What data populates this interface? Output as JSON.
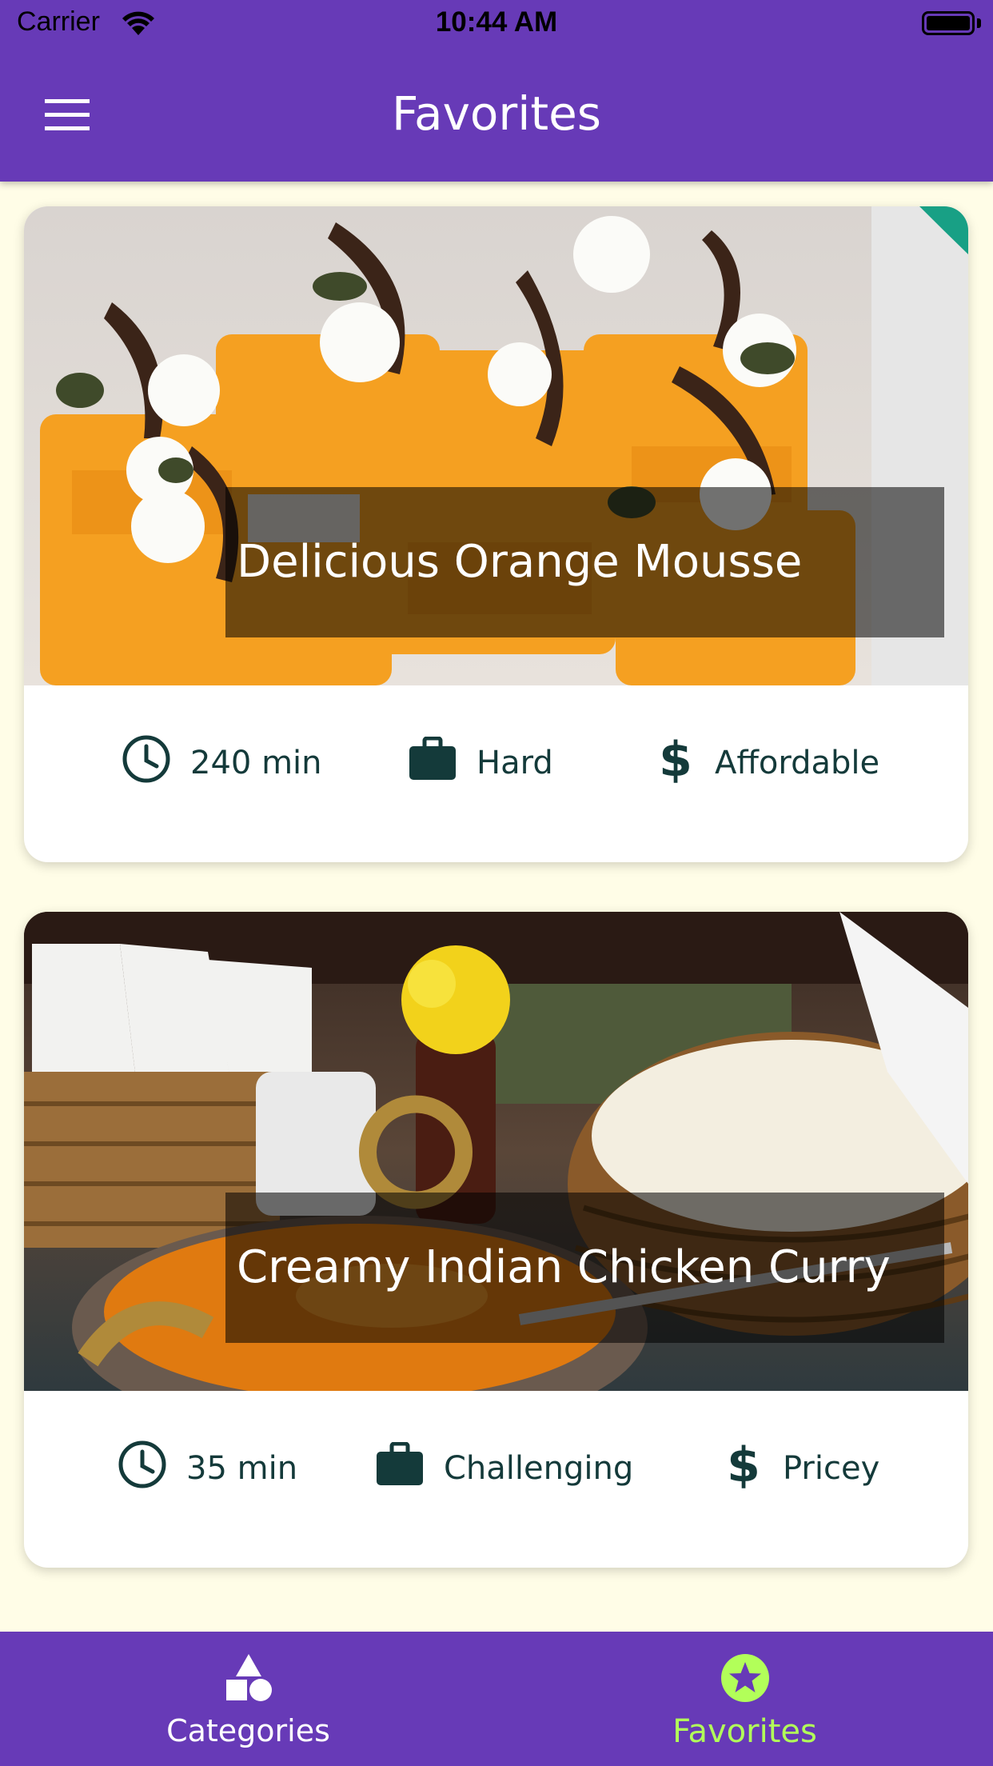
{
  "status_bar": {
    "carrier": "Carrier",
    "time": "10:44 AM"
  },
  "app_bar": {
    "title": "Favorites",
    "menu_icon": "hamburger-menu-icon"
  },
  "meals": [
    {
      "title": "Delicious Orange Mousse",
      "duration": "240 min",
      "complexity": "Hard",
      "affordability": "Affordable"
    },
    {
      "title": "Creamy Indian Chicken Curry",
      "duration": "35 min",
      "complexity": "Challenging",
      "affordability": "Pricey"
    }
  ],
  "tabs": [
    {
      "label": "Categories",
      "icon": "categories-icon",
      "active": false
    },
    {
      "label": "Favorites",
      "icon": "star-icon",
      "active": true
    }
  ],
  "colors": {
    "primary": "#673ab7",
    "accent": "#b2ff59",
    "background": "#fffde7",
    "detail_text": "#143a3a"
  }
}
